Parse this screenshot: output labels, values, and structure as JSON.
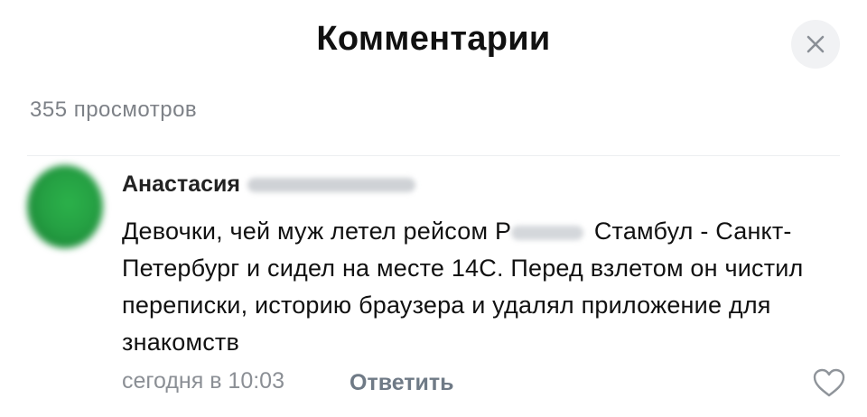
{
  "header": {
    "title": "Комментарии",
    "close_icon": "close-icon"
  },
  "stats": {
    "views": "355 просмотров"
  },
  "comment": {
    "author_first_name": "Анастасия",
    "text_before_flight": "Девочки, чей муж летел рейсом Р",
    "text_after_flight": "Стамбул - Санкт-Петербург и сидел на месте 14С. Перед взлетом он чистил переписки, историю браузера и удалял приложение для знакомств",
    "timestamp": "сегодня в 10:03",
    "reply_label": "Ответить",
    "like_icon": "heart-outline-icon"
  },
  "colors": {
    "avatar": "#25a043",
    "muted": "#7d8187",
    "reply": "#6f7a86",
    "close_bg": "#f1f2f4"
  }
}
